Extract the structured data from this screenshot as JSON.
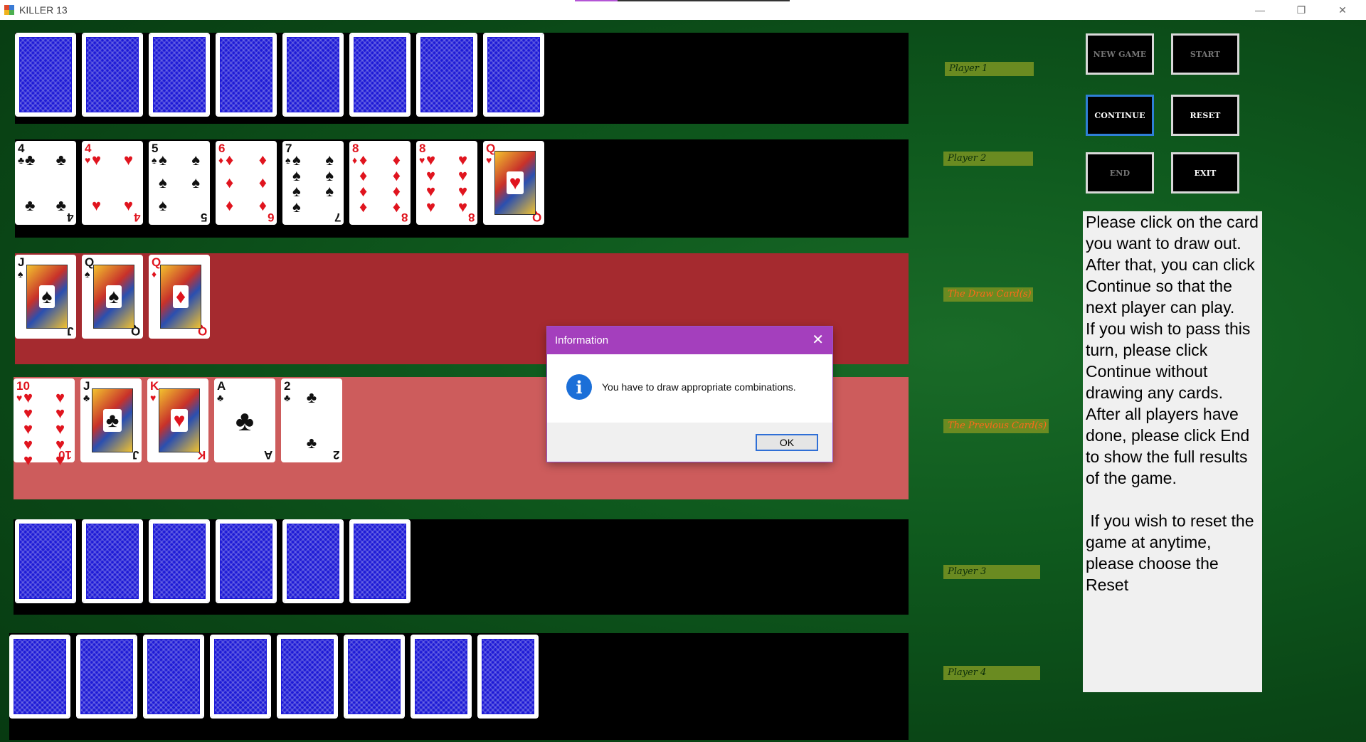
{
  "window": {
    "title": "KILLER 13",
    "minimize": "—",
    "restore": "❐",
    "close": "✕"
  },
  "hands": {
    "player1_backs": 8,
    "player2_cards": [
      {
        "rank": "4",
        "suit": "♣",
        "color": "black"
      },
      {
        "rank": "4",
        "suit": "♥",
        "color": "red"
      },
      {
        "rank": "5",
        "suit": "♠",
        "color": "black"
      },
      {
        "rank": "6",
        "suit": "♦",
        "color": "red"
      },
      {
        "rank": "7",
        "suit": "♠",
        "color": "black"
      },
      {
        "rank": "8",
        "suit": "♦",
        "color": "red"
      },
      {
        "rank": "8",
        "suit": "♥",
        "color": "red"
      },
      {
        "rank": "Q",
        "suit": "♥",
        "color": "red"
      }
    ],
    "draw_cards": [
      {
        "rank": "J",
        "suit": "♠",
        "color": "black"
      },
      {
        "rank": "Q",
        "suit": "♠",
        "color": "black"
      },
      {
        "rank": "Q",
        "suit": "♦",
        "color": "red"
      }
    ],
    "previous_cards": [
      {
        "rank": "10",
        "suit": "♥",
        "color": "red"
      },
      {
        "rank": "J",
        "suit": "♣",
        "color": "black"
      },
      {
        "rank": "K",
        "suit": "♥",
        "color": "red"
      },
      {
        "rank": "A",
        "suit": "♣",
        "color": "black"
      },
      {
        "rank": "2",
        "suit": "♣",
        "color": "black"
      }
    ],
    "player3_backs": 6,
    "player4_backs": 8
  },
  "labels": {
    "player1": "Player 1",
    "player2": "Player 2",
    "draw": "The Draw Card(s)",
    "previous": "The Previous Card(s)",
    "player3": "Player 3",
    "player4": "Player 4"
  },
  "controls": {
    "new_game": "NEW GAME",
    "start": "START",
    "continue": "CONTINUE",
    "reset": "RESET",
    "end": "END",
    "exit": "EXIT"
  },
  "help_text": "Please click on the card you want to draw out. After that, you can click Continue so that the next player can play.\nIf you wish to pass this turn, please click Continue without drawing any cards.\nAfter all players have done, please click End to show the full results of the game.\n\n If you wish to reset the game at anytime, please choose the Reset",
  "dialog": {
    "title": "Information",
    "close": "✕",
    "icon": "i",
    "message": "You have to draw appropriate combinations.",
    "ok": "OK"
  },
  "colors": {
    "felt": "#0f5a1e",
    "draw_zone": "#a52a2f",
    "previous_zone": "#cd5c5c",
    "dialog_title": "#a43fbd",
    "label_bg": "#6a8b21"
  }
}
